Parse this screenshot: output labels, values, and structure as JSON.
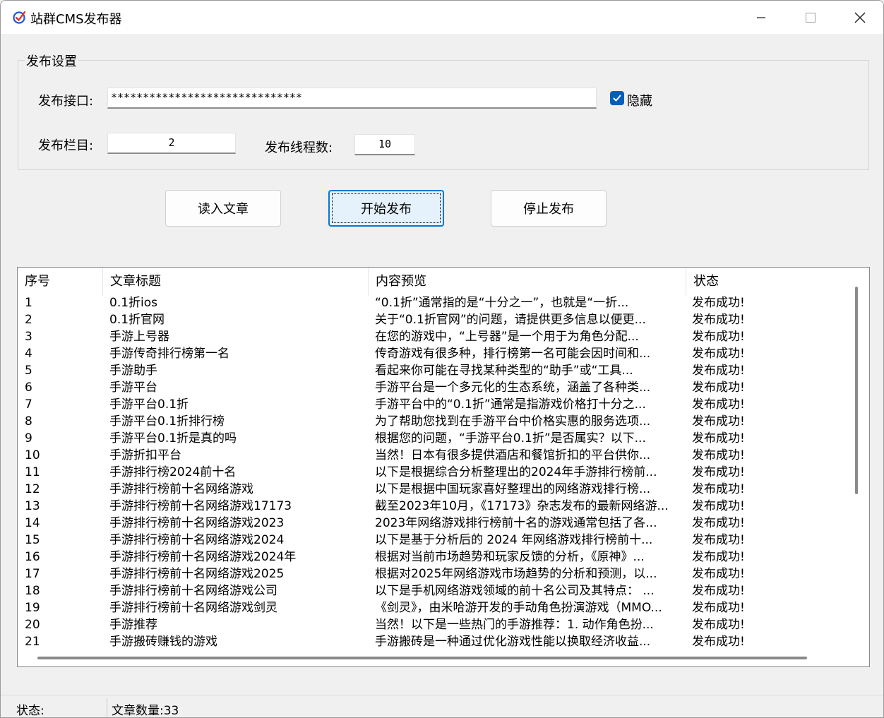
{
  "window": {
    "title": "站群CMS发布器",
    "accent": "#005fb8"
  },
  "settings": {
    "group_title": "发布设置",
    "api_label": "发布接口:",
    "api_value": "******************************",
    "hide_label": "隐藏",
    "hide_checked": true,
    "category_label": "发布栏目:",
    "category_value": "2",
    "threads_label": "发布线程数:",
    "threads_value": "10"
  },
  "buttons": {
    "read": "读入文章",
    "start": "开始发布",
    "stop": "停止发布"
  },
  "table": {
    "headers": [
      "序号",
      "文章标题",
      "内容预览",
      "状态"
    ],
    "rows": [
      [
        "1",
        "0.1折ios",
        "“0.1折”通常指的是“十分之一”，也就是“一折...",
        "发布成功!"
      ],
      [
        "2",
        "0.1折官网",
        "关于“0.1折官网”的问题，请提供更多信息以便更...",
        "发布成功!"
      ],
      [
        "3",
        "手游上号器",
        "在您的游戏中，“上号器”是一个用于为角色分配...",
        "发布成功!"
      ],
      [
        "4",
        "手游传奇排行榜第一名",
        "传奇游戏有很多种，排行榜第一名可能会因时间和...",
        "发布成功!"
      ],
      [
        "5",
        "手游助手",
        "看起来你可能在寻找某种类型的“助手”或“工具...",
        "发布成功!"
      ],
      [
        "6",
        "手游平台",
        "手游平台是一个多元化的生态系统，涵盖了各种类...",
        "发布成功!"
      ],
      [
        "7",
        "手游平台0.1折",
        "手游平台中的“0.1折”通常是指游戏价格打十分之...",
        "发布成功!"
      ],
      [
        "8",
        "手游平台0.1折排行榜",
        "为了帮助您找到在手游平台中价格实惠的服务选项...",
        "发布成功!"
      ],
      [
        "9",
        "手游平台0.1折是真的吗",
        "根据您的问题，“手游平台0.1折”是否属实？以下...",
        "发布成功!"
      ],
      [
        "10",
        "手游折扣平台",
        "当然！日本有很多提供酒店和餐馆折扣的平台供你...",
        "发布成功!"
      ],
      [
        "11",
        "手游排行榜2024前十名",
        "以下是根据综合分析整理出的2024年手游排行榜前...",
        "发布成功!"
      ],
      [
        "12",
        "手游排行榜前十名网络游戏",
        "以下是根据中国玩家喜好整理出的网络游戏排行榜...",
        "发布成功!"
      ],
      [
        "13",
        "手游排行榜前十名网络游戏17173",
        "截至2023年10月，《17173》杂志发布的最新网络游...",
        "发布成功!"
      ],
      [
        "14",
        "手游排行榜前十名网络游戏2023",
        "2023年网络游戏排行榜前十名的游戏通常包括了各...",
        "发布成功!"
      ],
      [
        "15",
        "手游排行榜前十名网络游戏2024",
        "以下是基于分析后的 2024 年网络游戏排行榜前十...",
        "发布成功!"
      ],
      [
        "16",
        "手游排行榜前十名网络游戏2024年",
        "根据对当前市场趋势和玩家反馈的分析，《原神》...",
        "发布成功!"
      ],
      [
        "17",
        "手游排行榜前十名网络游戏2025",
        "根据对2025年网络游戏市场趋势的分析和预测，以...",
        "发布成功!"
      ],
      [
        "18",
        "手游排行榜前十名网络游戏公司",
        "以下是手机网络游戏领域的前十名公司及其特点： ...",
        "发布成功!"
      ],
      [
        "19",
        "手游排行榜前十名网络游戏剑灵",
        "《剑灵》，由米哈游开发的手动角色扮演游戏（MMO...",
        "发布成功!"
      ],
      [
        "20",
        "手游推荐",
        "当然！以下是一些热门的手游推荐：1. 动作角色扮...",
        "发布成功!"
      ],
      [
        "21",
        "手游搬砖赚钱的游戏",
        "手游搬砖是一种通过优化游戏性能以换取经济收益...",
        "发布成功!"
      ]
    ]
  },
  "statusbar": {
    "status_label": "状态:",
    "count_text": "文章数量:33"
  }
}
